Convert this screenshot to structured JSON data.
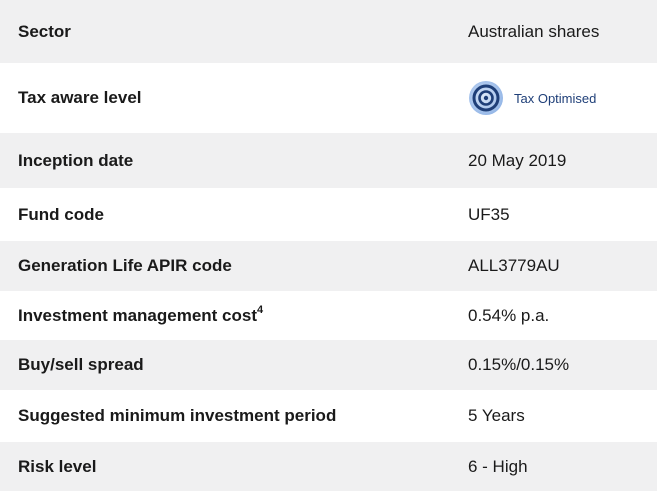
{
  "rows": [
    {
      "label": "Sector",
      "value": "Australian shares"
    },
    {
      "label": "Tax aware level",
      "badge_text": "Tax Optimised",
      "badge_icon": "concentric-circles-icon",
      "badge_color": "#1f3f78"
    },
    {
      "label": "Inception date",
      "value": "20 May 2019"
    },
    {
      "label": "Fund code",
      "value": "UF35"
    },
    {
      "label": "Generation Life APIR code",
      "value": "ALL3779AU"
    },
    {
      "label": "Investment management cost",
      "footnote": "4",
      "value": "0.54% p.a."
    },
    {
      "label": "Buy/sell spread",
      "value": "0.15%/0.15%"
    },
    {
      "label": "Suggested minimum investment period",
      "value": "5 Years"
    },
    {
      "label": "Risk level",
      "value": "6 - High"
    }
  ],
  "colors": {
    "row_shade": "#f0f0f1",
    "text": "#1a1a1a",
    "badge_dark": "#1f3f78",
    "badge_light": "#8fb3e6"
  }
}
